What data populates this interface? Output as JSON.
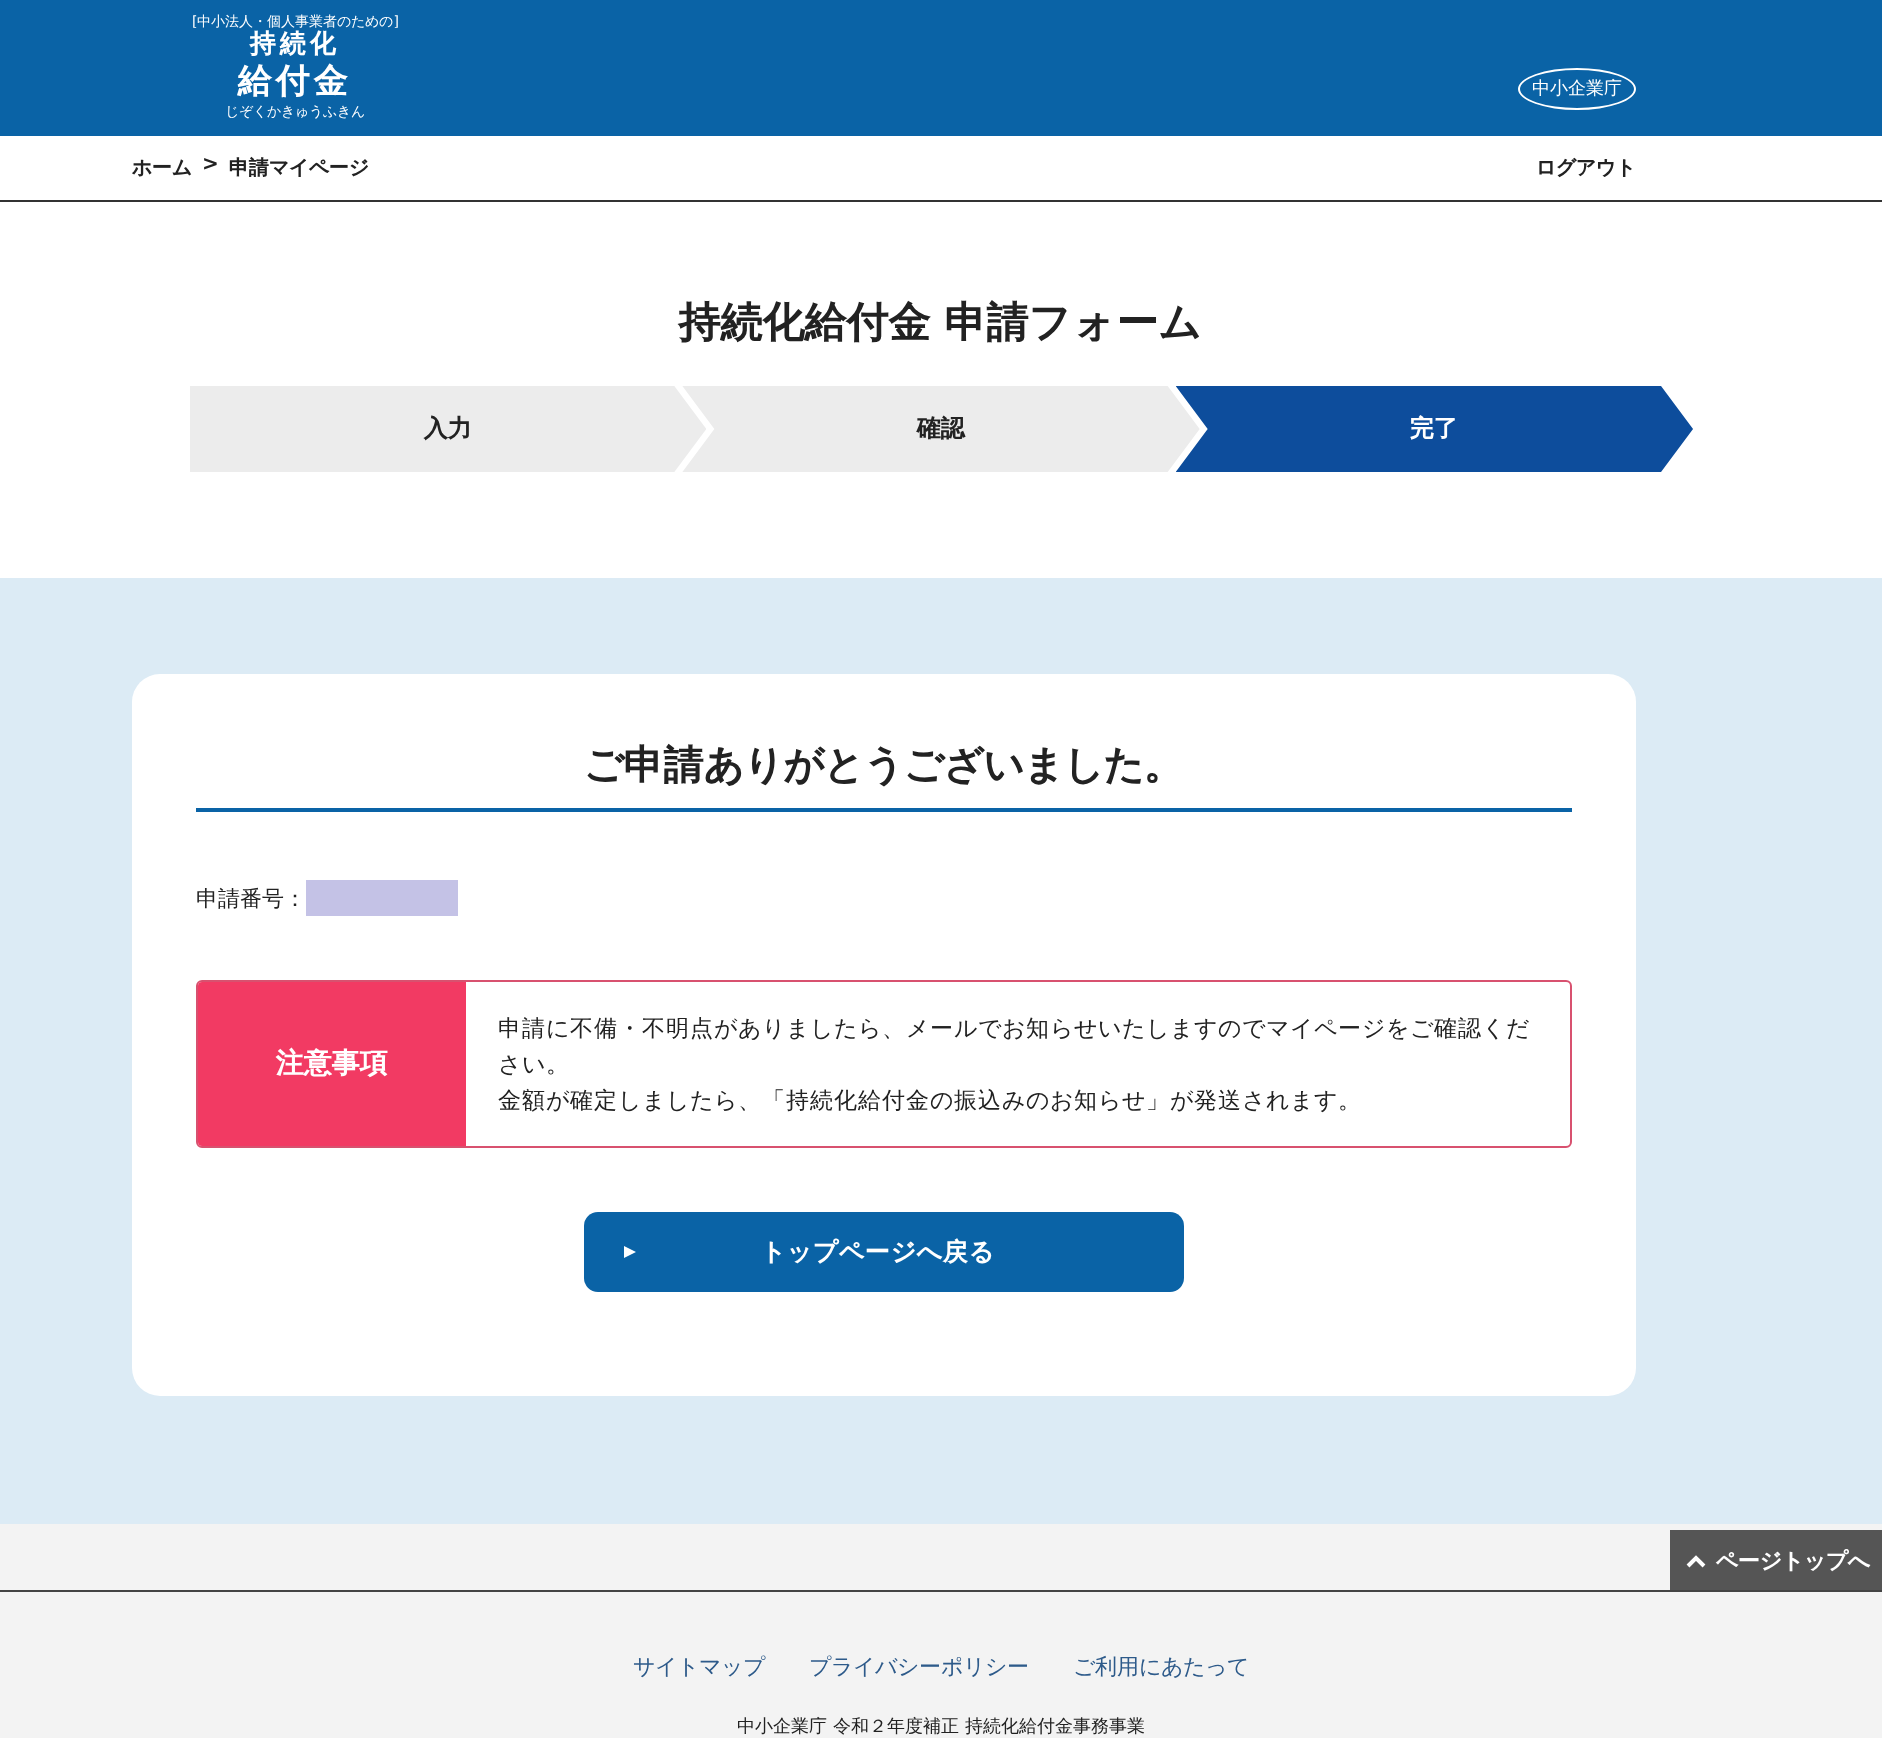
{
  "header": {
    "logo_tagline": "[中小法人・個人事業者のための]",
    "logo_top": "持続化",
    "logo_main": "給付金",
    "logo_reading": "じぞくかきゅうふきん",
    "agency_logo": "中小企業庁"
  },
  "breadcrumb": [
    {
      "label": "ホーム"
    },
    {
      "label": "申請マイページ"
    }
  ],
  "breadcrumb_separator": ">",
  "logout": "ログアウト",
  "form_title": "持続化給付金 申請フォーム",
  "steps": [
    {
      "label": "入力",
      "selected": false
    },
    {
      "label": "確認",
      "selected": false
    },
    {
      "label": "完了",
      "selected": true
    }
  ],
  "card": {
    "heading": "ご申請ありがとうございました。",
    "number_label": "申請番号：",
    "notice": {
      "label": "注意事項",
      "lines": [
        "申請に不備・不明点がありましたら、メールでお知らせいたしますのでマイページをご確認ください。",
        "金額が確定しましたら、「持続化給付金の振込みのお知らせ」が発送されます。"
      ]
    },
    "button": "トップページへ戻る"
  },
  "page_top": "ページトップへ",
  "footer": {
    "links": [
      "サイトマップ",
      "プライバシーポリシー",
      "ご利用にあたって"
    ],
    "copyright": "中小企業庁 令和２年度補正 持続化給付金事務事業"
  }
}
